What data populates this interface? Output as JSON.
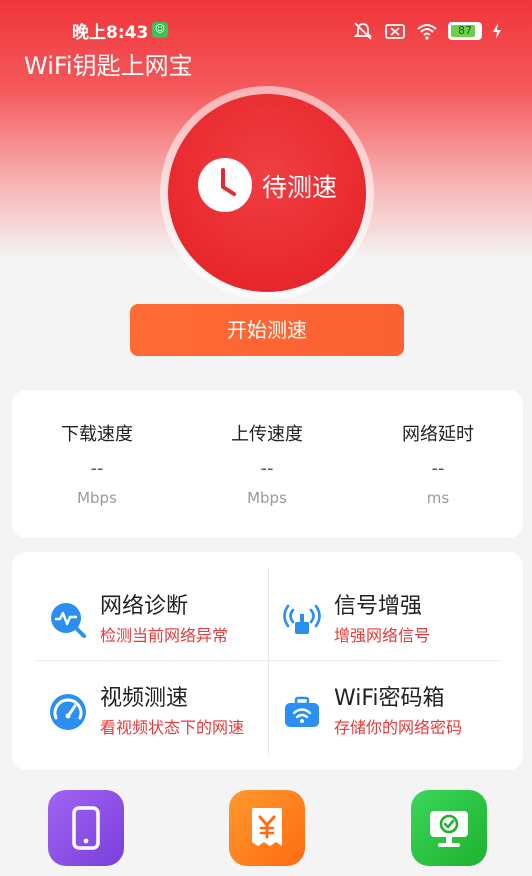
{
  "status_bar": {
    "time": "晚上8:43",
    "battery_level": "87",
    "battery_fraction": 0.87,
    "icons": [
      "wechat-icon",
      "mute-icon",
      "close-box-icon",
      "wifi-icon",
      "battery-icon",
      "charging-icon"
    ]
  },
  "header": {
    "title": "WiFi钥匙上网宝"
  },
  "speed_test": {
    "status": "待测速",
    "start_button": "开始测速",
    "icon": "clock-icon"
  },
  "stats": [
    {
      "label": "下载速度",
      "value": "--",
      "unit": "Mbps"
    },
    {
      "label": "上传速度",
      "value": "--",
      "unit": "Mbps"
    },
    {
      "label": "网络延时",
      "value": "--",
      "unit": "ms"
    }
  ],
  "tools": [
    {
      "title": "网络诊断",
      "subtitle": "检测当前网络异常",
      "icon": "network-diagnose-icon"
    },
    {
      "title": "信号增强",
      "subtitle": "增强网络信号",
      "icon": "signal-boost-icon"
    },
    {
      "title": "视频测速",
      "subtitle": "看视频状态下的网速",
      "icon": "speedometer-icon"
    },
    {
      "title": "WiFi密码箱",
      "subtitle": "存储你的网络密码",
      "icon": "password-box-icon"
    }
  ],
  "bottom_apps": [
    {
      "icon": "phone-icon",
      "color": "#8a4ce6"
    },
    {
      "icon": "yen-receipt-icon",
      "color": "#ff7a1a"
    },
    {
      "icon": "monitor-check-icon",
      "color": "#25c23a"
    }
  ],
  "colors": {
    "primary_red": "#e8282d",
    "accent_orange": "#ff6b35",
    "subtitle_red": "#e83a3a",
    "icon_blue": "#2a8ff0"
  }
}
